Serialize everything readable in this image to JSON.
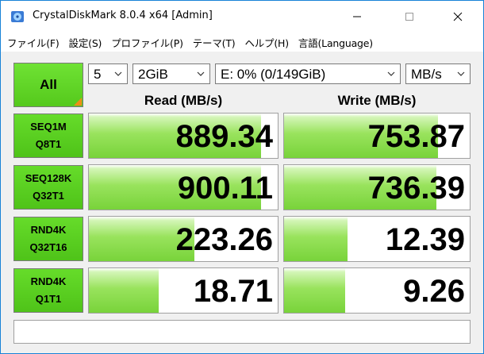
{
  "window": {
    "title": "CrystalDiskMark 8.0.4 x64 [Admin]"
  },
  "menu": [
    "ファイル(F)",
    "設定(S)",
    "プロファイル(P)",
    "テーマ(T)",
    "ヘルプ(H)",
    "言語(Language)"
  ],
  "controls": {
    "all_label": "All",
    "count": "5",
    "size": "2GiB",
    "drive": "E: 0% (0/149GiB)",
    "unit": "MB/s"
  },
  "headers": {
    "read": "Read (MB/s)",
    "write": "Write (MB/s)"
  },
  "tests": [
    {
      "line1": "SEQ1M",
      "line2": "Q8T1",
      "read": "889.34",
      "write": "753.87",
      "read_level": 0.91,
      "write_level": 0.83
    },
    {
      "line1": "SEQ128K",
      "line2": "Q32T1",
      "read": "900.11",
      "write": "736.39",
      "read_level": 0.91,
      "write_level": 0.82
    },
    {
      "line1": "RND4K",
      "line2": "Q32T16",
      "read": "223.26",
      "write": "12.39",
      "read_level": 0.56,
      "write_level": 0.34
    },
    {
      "line1": "RND4K",
      "line2": "Q1T1",
      "read": "18.71",
      "write": "9.26",
      "read_level": 0.37,
      "write_level": 0.33
    }
  ],
  "comment": "",
  "colors": {
    "accent_green": "#55c91c",
    "corner_orange": "#f08c16",
    "window_border": "#1883d7"
  },
  "icons": {
    "app": "crystaldiskmark-icon",
    "minimize": "minimize-icon",
    "maximize": "maximize-icon",
    "close": "close-icon",
    "dropdown": "chevron-down-icon"
  }
}
